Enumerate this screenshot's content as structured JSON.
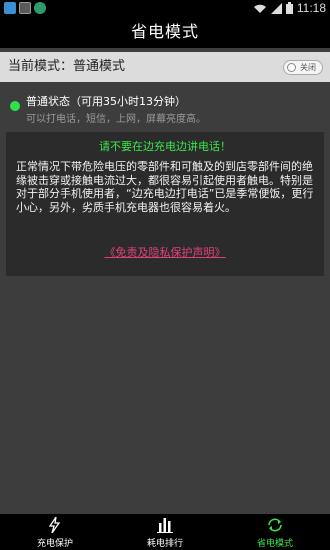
{
  "statusbar": {
    "time": "11:18"
  },
  "header": {
    "title": "省电模式"
  },
  "mode": {
    "label": "当前模式：普通模式",
    "toggle_text": "关闭"
  },
  "status": {
    "title": "普通状态（可用35小时13分钟）",
    "subtitle": "可以打电话，短信，上网，屏幕亮度高。"
  },
  "notice": {
    "warning": "请不要在边充电边讲电话！",
    "body": "正常情况下带危险电压的零部件和可触及的到店零部件间的绝缘被击穿或接触电流过大，都很容易引起使用者触电。特别是对于部分手机使用者，“边充电边打电话”已是季常便饭，更行小心，另外，劣质手机充电器也很容易着火。",
    "link": "《免责及隐私保护声明》"
  },
  "tabs": [
    {
      "label": "充电保护",
      "icon": "lightning-icon"
    },
    {
      "label": "耗电排行",
      "icon": "bar-chart-icon"
    },
    {
      "label": "省电模式",
      "icon": "battery-cycle-icon",
      "active": true
    }
  ],
  "colors": {
    "accent": "#39e64a",
    "link": "#e0407d",
    "background": "#3d3d3d"
  }
}
